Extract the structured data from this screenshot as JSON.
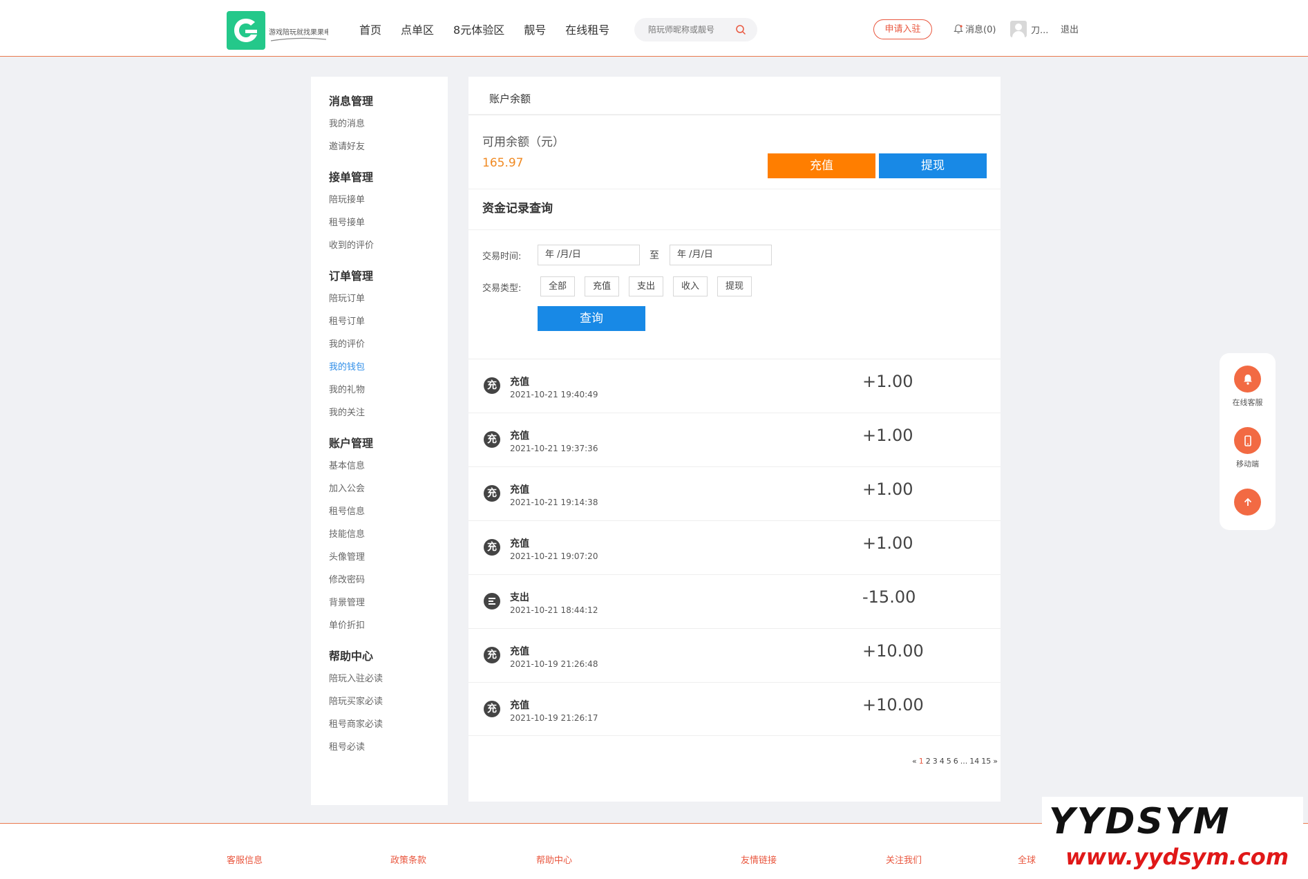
{
  "header": {
    "logo_text": "游戏陪玩就找果果电竞",
    "nav": [
      "首页",
      "点单区",
      "8元体验区",
      "靓号",
      "在线租号"
    ],
    "search_placeholder": "陪玩师昵称或靓号",
    "apply_label": "申请入驻",
    "messages_label": "消息(0)",
    "username": "刀...",
    "logout_label": "退出"
  },
  "sidebar": {
    "groups": [
      {
        "title": "消息管理",
        "items": [
          "我的消息",
          "邀请好友"
        ]
      },
      {
        "title": "接单管理",
        "items": [
          "陪玩接单",
          "租号接单",
          "收到的评价"
        ]
      },
      {
        "title": "订单管理",
        "items": [
          "陪玩订单",
          "租号订单",
          "我的评价",
          "我的钱包",
          "我的礼物",
          "我的关注"
        ]
      },
      {
        "title": "账户管理",
        "items": [
          "基本信息",
          "加入公会",
          "租号信息",
          "技能信息",
          "头像管理",
          "修改密码",
          "背景管理",
          "单价折扣"
        ]
      },
      {
        "title": "帮助中心",
        "items": [
          "陪玩入驻必读",
          "陪玩买家必读",
          "租号商家必读",
          "租号必读"
        ]
      }
    ],
    "active_item": "我的钱包"
  },
  "main": {
    "heading": "账户余额",
    "balance_label": "可用余额（元）",
    "balance_value": "165.97",
    "recharge_label": "充值",
    "withdraw_label": "提现",
    "records_title": "资金记录查询",
    "filter": {
      "time_label": "交易时间:",
      "date_placeholder_from": "年 /月/日",
      "to_label": "至",
      "date_placeholder_to": "年 /月/日",
      "type_label": "交易类型:",
      "types": [
        "全部",
        "充值",
        "支出",
        "收入",
        "提现"
      ],
      "query_label": "查询"
    },
    "records": [
      {
        "icon": "充",
        "type": "充值",
        "time": "2021-10-21 19:40:49",
        "amount": "+1.00"
      },
      {
        "icon": "充",
        "type": "充值",
        "time": "2021-10-21 19:37:36",
        "amount": "+1.00"
      },
      {
        "icon": "充",
        "type": "充值",
        "time": "2021-10-21 19:14:38",
        "amount": "+1.00"
      },
      {
        "icon": "充",
        "type": "充值",
        "time": "2021-10-21 19:07:20",
        "amount": "+1.00"
      },
      {
        "icon": "",
        "type": "支出",
        "time": "2021-10-21 18:44:12",
        "amount": "-15.00"
      },
      {
        "icon": "充",
        "type": "充值",
        "time": "2021-10-19 21:26:48",
        "amount": "+10.00"
      },
      {
        "icon": "充",
        "type": "充值",
        "time": "2021-10-19 21:26:17",
        "amount": "+10.00"
      }
    ],
    "pagination": {
      "prev": "«",
      "pages": [
        "1",
        "2",
        "3",
        "4",
        "5",
        "6",
        "...",
        "14",
        "15"
      ],
      "current": "1",
      "next": "»"
    }
  },
  "float_tools": {
    "service_label": "在线客服",
    "mobile_label": "移动端"
  },
  "footer": {
    "columns": [
      "客服信息",
      "政策条款",
      "帮助中心",
      "友情链接",
      "关注我们",
      "全球"
    ]
  },
  "watermark": {
    "line1": "YYDSYM",
    "line2": "www.yydsym.com"
  },
  "colors": {
    "accent_orange": "#ff7e00",
    "accent_blue": "#1889e6",
    "accent_red": "#e9573f",
    "brand_green": "#24c88a"
  }
}
